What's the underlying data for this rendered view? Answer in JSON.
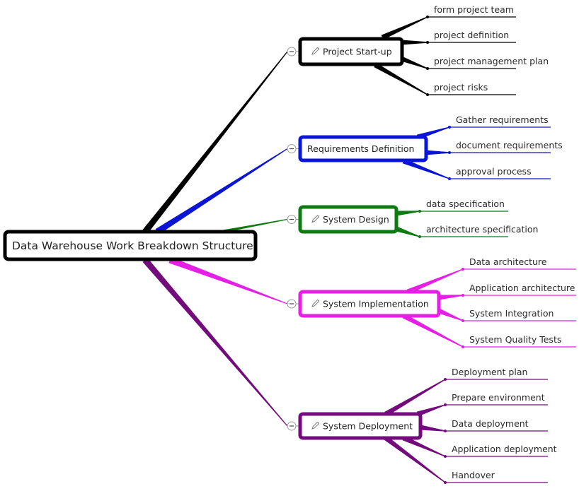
{
  "root": {
    "label": "Data Warehouse Work Breakdown Structure",
    "color": "#000000"
  },
  "branches": [
    {
      "label": "Project Start-up",
      "color": "#000000",
      "has_edit_icon": true,
      "collapse_icon": "collapse-minus-icon",
      "children": [
        "form project team",
        "project definition",
        "project management plan",
        "project risks"
      ]
    },
    {
      "label": "Requirements Definition",
      "color": "#0a14d6",
      "has_edit_icon": false,
      "collapse_icon": "collapse-minus-icon",
      "children": [
        "Gather requirements",
        "document requirements",
        "approval process"
      ]
    },
    {
      "label": "System Design",
      "color": "#0e7a12",
      "has_edit_icon": true,
      "collapse_icon": "collapse-minus-icon",
      "children": [
        "data specification",
        "architecture specification"
      ]
    },
    {
      "label": "System Implementation",
      "color": "#e61ee6",
      "has_edit_icon": true,
      "collapse_icon": "collapse-minus-icon",
      "children": [
        "Data architecture",
        "Application architecture",
        "System Integration",
        "System Quality Tests"
      ]
    },
    {
      "label": "System Deployment",
      "color": "#740b7c",
      "has_edit_icon": true,
      "collapse_icon": "collapse-minus-icon",
      "children": [
        "Deployment plan",
        "Prepare environment",
        "Data deployment",
        "Application deployment",
        "Handover"
      ]
    }
  ]
}
